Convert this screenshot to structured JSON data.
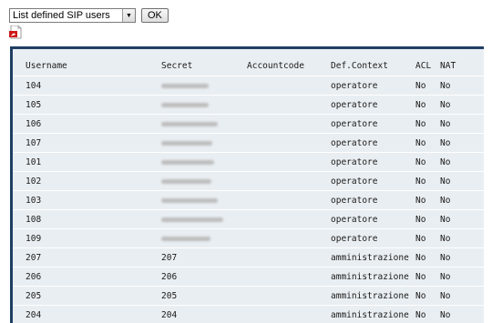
{
  "toolbar": {
    "select_value": "List defined SIP users",
    "ok_label": "OK",
    "pdf_icon": "pdf-export-icon"
  },
  "table": {
    "headers": {
      "username": "Username",
      "secret": "Secret",
      "accountcode": "Accountcode",
      "context": "Def.Context",
      "acl": "ACL",
      "nat": "NAT"
    },
    "rows": [
      {
        "username": "104",
        "secret": "",
        "secret_redacted": true,
        "accountcode": "",
        "context": "operatore",
        "acl": "No",
        "nat": "No"
      },
      {
        "username": "105",
        "secret": "",
        "secret_redacted": true,
        "accountcode": "",
        "context": "operatore",
        "acl": "No",
        "nat": "No"
      },
      {
        "username": "106",
        "secret": "",
        "secret_redacted": true,
        "accountcode": "",
        "context": "operatore",
        "acl": "No",
        "nat": "No"
      },
      {
        "username": "107",
        "secret": "",
        "secret_redacted": true,
        "accountcode": "",
        "context": "operatore",
        "acl": "No",
        "nat": "No"
      },
      {
        "username": "101",
        "secret": "",
        "secret_redacted": true,
        "accountcode": "",
        "context": "operatore",
        "acl": "No",
        "nat": "No"
      },
      {
        "username": "102",
        "secret": "",
        "secret_redacted": true,
        "accountcode": "",
        "context": "operatore",
        "acl": "No",
        "nat": "No"
      },
      {
        "username": "103",
        "secret": "",
        "secret_redacted": true,
        "accountcode": "",
        "context": "operatore",
        "acl": "No",
        "nat": "No"
      },
      {
        "username": "108",
        "secret": "",
        "secret_redacted": true,
        "accountcode": "",
        "context": "operatore",
        "acl": "No",
        "nat": "No"
      },
      {
        "username": "109",
        "secret": "",
        "secret_redacted": true,
        "accountcode": "",
        "context": "operatore",
        "acl": "No",
        "nat": "No"
      },
      {
        "username": "207",
        "secret": "207",
        "secret_redacted": false,
        "accountcode": "",
        "context": "amministrazione",
        "acl": "No",
        "nat": "No"
      },
      {
        "username": "206",
        "secret": "206",
        "secret_redacted": false,
        "accountcode": "",
        "context": "amministrazione",
        "acl": "No",
        "nat": "No"
      },
      {
        "username": "205",
        "secret": "205",
        "secret_redacted": false,
        "accountcode": "",
        "context": "amministrazione",
        "acl": "No",
        "nat": "No"
      },
      {
        "username": "204",
        "secret": "204",
        "secret_redacted": false,
        "accountcode": "",
        "context": "amministrazione",
        "acl": "No",
        "nat": "No"
      }
    ]
  },
  "colors": {
    "panel_border": "#1f3e63",
    "panel_background": "#e9eef2"
  }
}
